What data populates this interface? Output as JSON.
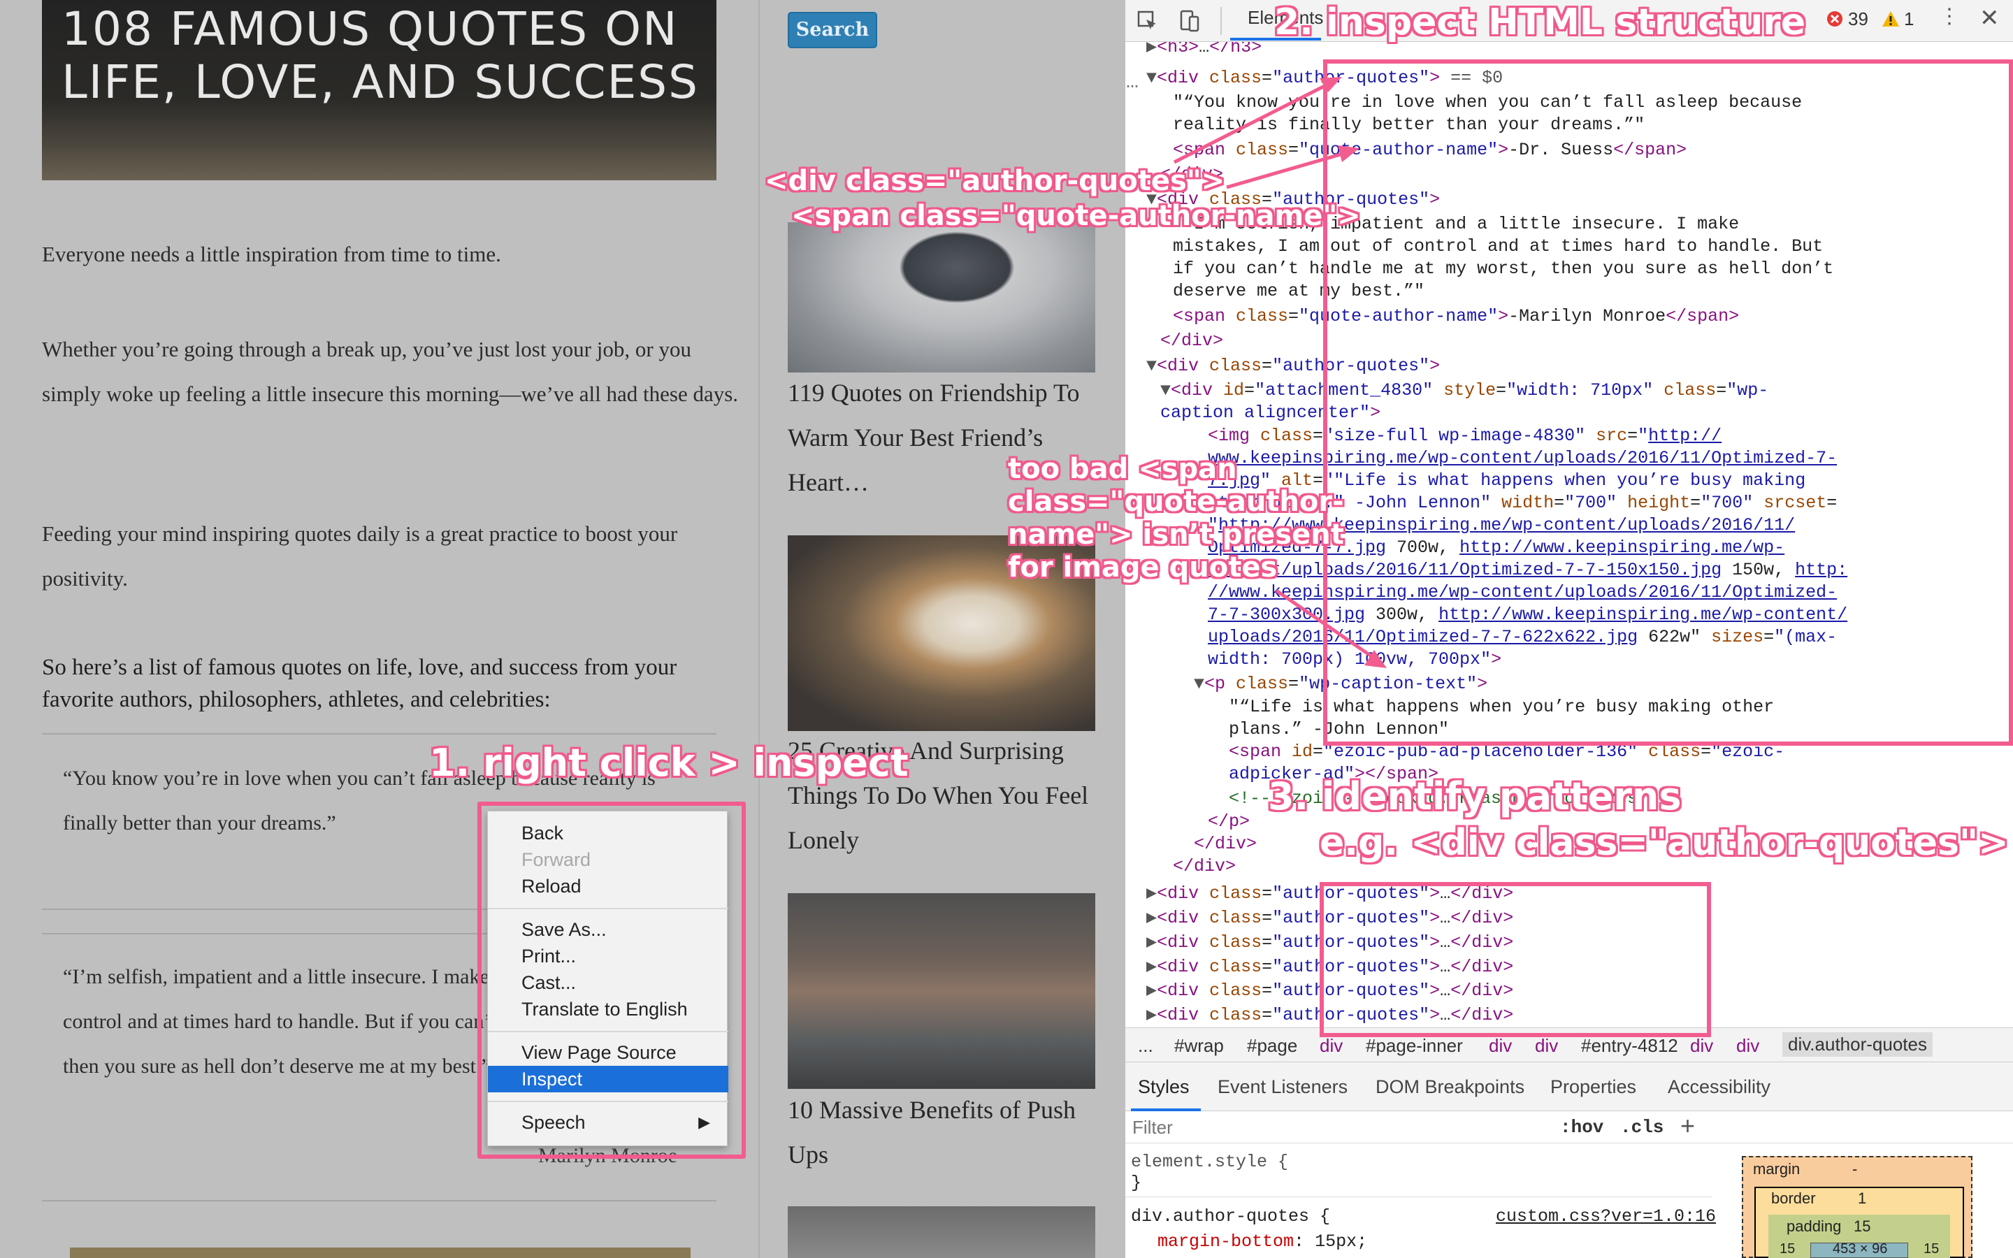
{
  "blog": {
    "hero_title": "108 FAMOUS QUOTES ON LIFE, LOVE, AND SUCCESS",
    "paragraphs": [
      "Everyone needs a little inspiration from time to time.",
      "Whether you’re going through a break up, you’ve just lost your job, or you simply woke up feeling a little insecure this morning—we’ve all had these days.",
      "Feeding your mind inspiring quotes daily is a great practice to boost your positivity."
    ],
    "list_heading": "So here’s a list of famous quotes on life, love, and success from your favorite authors, philosophers, athletes, and celebrities:",
    "quote1": "“You know you’re in love when you can’t fall asleep because reality is finally better than your dreams.”",
    "quote2": "“I’m selfish, impatient and a little insecure. I make mistakes, I am out of control and at times hard to handle. But if you can’t handle me at my worst, then you sure as hell don’t deserve me at my best.”",
    "quote2_author": "-Marilyn Monroe"
  },
  "sidebar": {
    "search_label": "Search",
    "posts": [
      {
        "title": "119 Quotes on Friendship To Warm Your Best Friend’s Heart…"
      },
      {
        "title": "25 Creative And Surprising Things To Do When You Feel Lonely"
      },
      {
        "title": "10 Massive Benefits of Push Ups"
      }
    ]
  },
  "devtools": {
    "tab_label": "Elements",
    "errors": "39",
    "warnings": "1",
    "breadcrumb": [
      "...",
      "#wrap",
      "#page",
      "div",
      "#page-inner",
      "div",
      "div",
      "#entry-4812",
      "div",
      "div",
      "div.author-quotes"
    ],
    "subtabs": [
      "Styles",
      "Event Listeners",
      "DOM Breakpoints",
      "Properties",
      "Accessibility"
    ],
    "filter_placeholder": "Filter",
    "hov": ":hov",
    "cls": ".cls",
    "element_style": "element.style {",
    "element_style_close": "}",
    "rule_selector": "div.author-quotes {",
    "rule_source": "custom.css?ver=1.0:16",
    "rule_prop": "margin-bottom",
    "rule_val": "15px;",
    "box_model": {
      "margin": "margin",
      "margin_val": "-",
      "border": "border",
      "border_val": "1",
      "padding": "padding",
      "padding_val": "15",
      "content": "453 × 96",
      "side_val": "15"
    }
  },
  "context_menu": {
    "items": [
      "Back",
      "Forward",
      "Reload",
      "Save As...",
      "Print...",
      "Cast...",
      "Translate to English",
      "View Page Source",
      "Inspect",
      "Speech"
    ]
  },
  "annotations": {
    "step1": "1. right click > inspect",
    "step2": "2. inspect HTML structure",
    "step3": "3. identify patterns",
    "step3_example": "e.g. <div class=\"author-quotes\">",
    "class_note_1": "<div class=\"author-quotes\">",
    "class_note_2": "<span class=\"quote-author-name\">",
    "image_note": [
      "too bad <span",
      "class=\"quote-author-",
      "name\"> isn’t present",
      "for image quotes"
    ]
  },
  "colors": {
    "accent": "#f25c8f",
    "search": "#2e80b4",
    "selection": "#1b6fd9"
  }
}
